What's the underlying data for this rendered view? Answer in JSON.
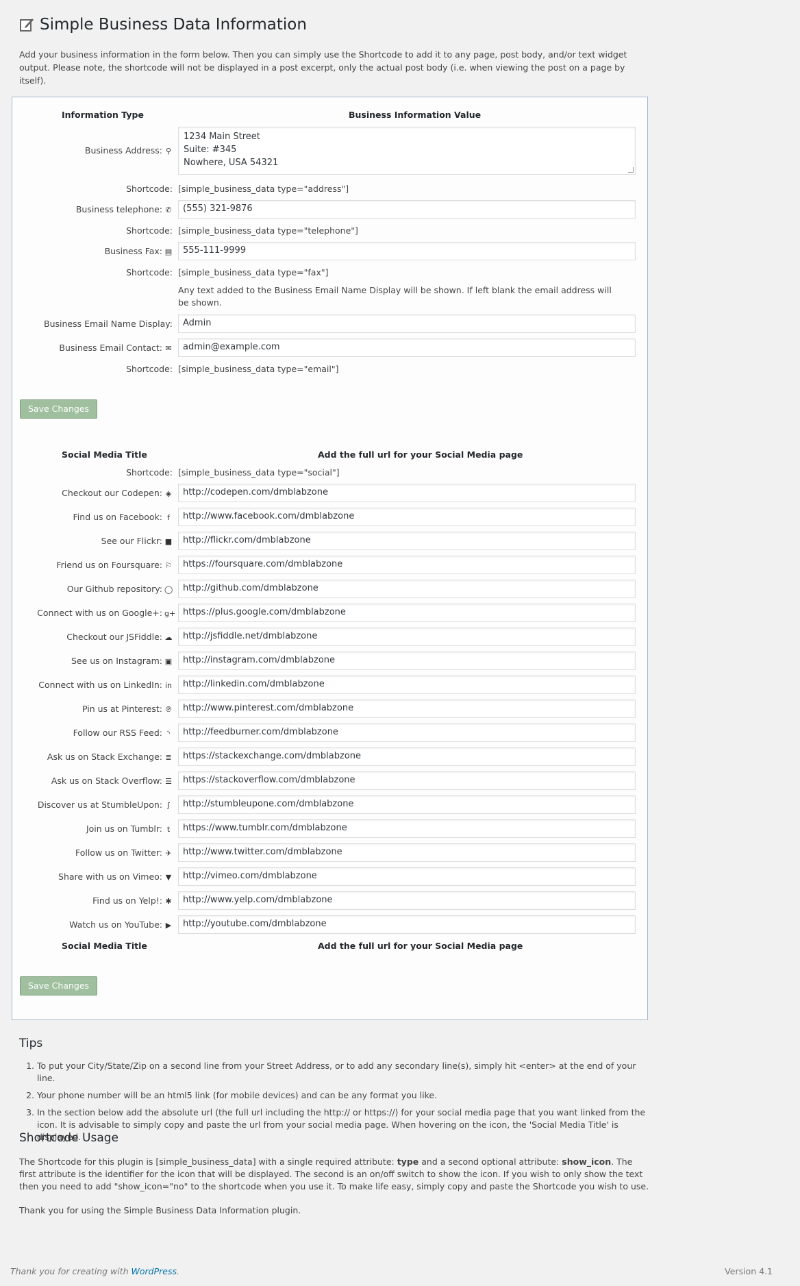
{
  "page": {
    "title": "Simple Business Data Information",
    "intro": "Add your business information in the form below. Then you can simply use the Shortcode to add it to any page, post body, and/or text widget output. Please note, the shortcode will not be displayed in a post excerpt, only the actual post body (i.e. when viewing the post on a page by itself)."
  },
  "business": {
    "col_type": "Information Type",
    "col_value": "Business Information Value",
    "shortcode_label": "Shortcode:",
    "address_label": "Business Address:",
    "address_value": "1234 Main Street\nSuite: #345\nNowhere, USA 54321",
    "address_shortcode": "[simple_business_data type=\"address\"]",
    "telephone_label": "Business telephone:",
    "telephone_value": "(555) 321-9876",
    "telephone_shortcode": "[simple_business_data type=\"telephone\"]",
    "fax_label": "Business Fax:",
    "fax_value": "555-111-9999",
    "fax_shortcode": "[simple_business_data type=\"fax\"]",
    "email_note": "Any text added to the Business Email Name Display will be shown. If left blank the email address will be shown.",
    "email_name_label": "Business Email Name Display:",
    "email_name_value": "Admin",
    "email_contact_label": "Business Email Contact:",
    "email_contact_value": "admin@example.com",
    "email_shortcode": "[simple_business_data type=\"email\"]",
    "save_label": "Save Changes"
  },
  "social": {
    "col_title": "Social Media Title",
    "col_url": "Add the full url for your Social Media page",
    "shortcode": "[simple_business_data type=\"social\"]",
    "items": [
      {
        "label": "Checkout our Codepen:",
        "icon": "codepen-icon",
        "glyph": "◈",
        "url": "http://codepen.com/dmblabzone"
      },
      {
        "label": "Find us on Facebook:",
        "icon": "facebook-icon",
        "glyph": "f",
        "url": "http://www.facebook.com/dmblabzone"
      },
      {
        "label": "See our Flickr:",
        "icon": "flickr-icon",
        "glyph": "■",
        "url": "http://flickr.com/dmblabzone"
      },
      {
        "label": "Friend us on Foursquare:",
        "icon": "foursquare-icon",
        "glyph": "⚐",
        "url": "https://foursquare.com/dmblabzone"
      },
      {
        "label": "Our Github repository:",
        "icon": "github-icon",
        "glyph": "◯",
        "url": "http://github.com/dmblabzone"
      },
      {
        "label": "Connect with us on Google+:",
        "icon": "google-plus-icon",
        "glyph": "g+",
        "url": "https://plus.google.com/dmblabzone"
      },
      {
        "label": "Checkout our JSFiddle:",
        "icon": "jsfiddle-icon",
        "glyph": "☁",
        "url": "http://jsfiddle.net/dmblabzone"
      },
      {
        "label": "See us on Instagram:",
        "icon": "instagram-icon",
        "glyph": "▣",
        "url": "http://instagram.com/dmblabzone"
      },
      {
        "label": "Connect with us on LinkedIn:",
        "icon": "linkedin-icon",
        "glyph": "in",
        "url": "http://linkedin.com/dmblabzone"
      },
      {
        "label": "Pin us at Pinterest:",
        "icon": "pinterest-icon",
        "glyph": "℗",
        "url": "http://www.pinterest.com/dmblabzone"
      },
      {
        "label": "Follow our RSS Feed:",
        "icon": "rss-icon",
        "glyph": "◝",
        "url": "http://feedburner.com/dmblabzone"
      },
      {
        "label": "Ask us on Stack Exchange:",
        "icon": "stack-exchange-icon",
        "glyph": "≣",
        "url": "https://stackexchange.com/dmblabzone"
      },
      {
        "label": "Ask us on Stack Overflow:",
        "icon": "stack-overflow-icon",
        "glyph": "☰",
        "url": "https://stackoverflow.com/dmblabzone"
      },
      {
        "label": "Discover us at StumbleUpon:",
        "icon": "stumbleupon-icon",
        "glyph": "ʃ",
        "url": "http://stumbleupone.com/dmblabzone"
      },
      {
        "label": "Join us on Tumblr:",
        "icon": "tumblr-icon",
        "glyph": "t",
        "url": "https://www.tumblr.com/dmblabzone"
      },
      {
        "label": "Follow us on Twitter:",
        "icon": "twitter-icon",
        "glyph": "✈",
        "url": "http://www.twitter.com/dmblabzone"
      },
      {
        "label": "Share with us on Vimeo:",
        "icon": "vimeo-icon",
        "glyph": "▼",
        "url": "http://vimeo.com/dmblabzone"
      },
      {
        "label": "Find us on Yelp!:",
        "icon": "yelp-icon",
        "glyph": "✱",
        "url": "http://www.yelp.com/dmblabzone"
      },
      {
        "label": "Watch us on YouTube:",
        "icon": "youtube-icon",
        "glyph": "▶",
        "url": "http://youtube.com/dmblabzone"
      }
    ],
    "save_label": "Save Changes"
  },
  "tips": {
    "title": "Tips",
    "items": [
      "To put your City/State/Zip on a second line from your Street Address, or to add any secondary line(s), simply hit <enter> at the end of your line.",
      "Your phone number will be an html5 link (for mobile devices) and can be any format you like.",
      "In the section below add the absolute url (the full url including the http:// or https://) for your social media page that you want linked from the icon. It is advisable to simply copy and paste the url from your social media page. When hovering on the icon, the 'Social Media Title' is displayed."
    ]
  },
  "usage": {
    "title": "Shortcode Usage",
    "p1_a": "The Shortcode for this plugin is [simple_business_data] with a single required attribute: ",
    "p1_b": "type",
    "p1_c": " and a second optional attribute: ",
    "p1_d": "show_icon",
    "p1_e": ". The first attribute is the identifier for the icon that will be displayed. The second is an on/off switch to show the icon. If you wish to only show the text then you need to add \"show_icon=\"no\" to the shortcode when you use it. To make life easy, simply copy and paste the Shortcode you wish to use.",
    "thanks": "Thank you for using the Simple Business Data Information plugin."
  },
  "footer": {
    "left_text": "Thank you for creating with ",
    "left_link": "WordPress",
    "left_end": ".",
    "version": "Version 4.1"
  }
}
